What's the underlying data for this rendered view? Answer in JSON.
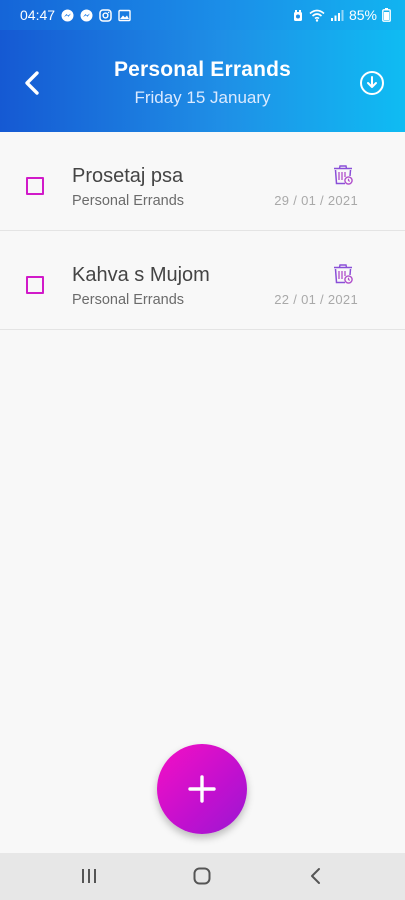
{
  "status_bar": {
    "time": "04:47",
    "battery": "85%",
    "left_icons": [
      "messenger-icon",
      "messenger-icon",
      "instagram-icon",
      "gallery-icon"
    ],
    "right_icons": [
      "alarm-icon",
      "wifi-icon",
      "signal-icon",
      "battery-icon"
    ]
  },
  "header": {
    "title": "Personal Errands",
    "subtitle": "Friday 15 January",
    "back_icon": "chevron-left-icon",
    "action_icon": "download-icon"
  },
  "tasks": [
    {
      "title": "Prosetaj psa",
      "category": "Personal Errands",
      "date": "29 / 01 / 2021",
      "checked": false
    },
    {
      "title": "Kahva s Mujom",
      "category": "Personal Errands",
      "date": "22 / 01 / 2021",
      "checked": false
    }
  ],
  "fab": {
    "icon": "plus-icon"
  },
  "nav_bar": {
    "buttons": [
      "recents-icon",
      "home-icon",
      "back-icon"
    ]
  },
  "colors": {
    "header_gradient": [
      "#1559d3",
      "#0fbcf3"
    ],
    "checkbox": "#d11ac9",
    "fab_gradient": [
      "#f50fc4",
      "#9a18d2"
    ]
  }
}
